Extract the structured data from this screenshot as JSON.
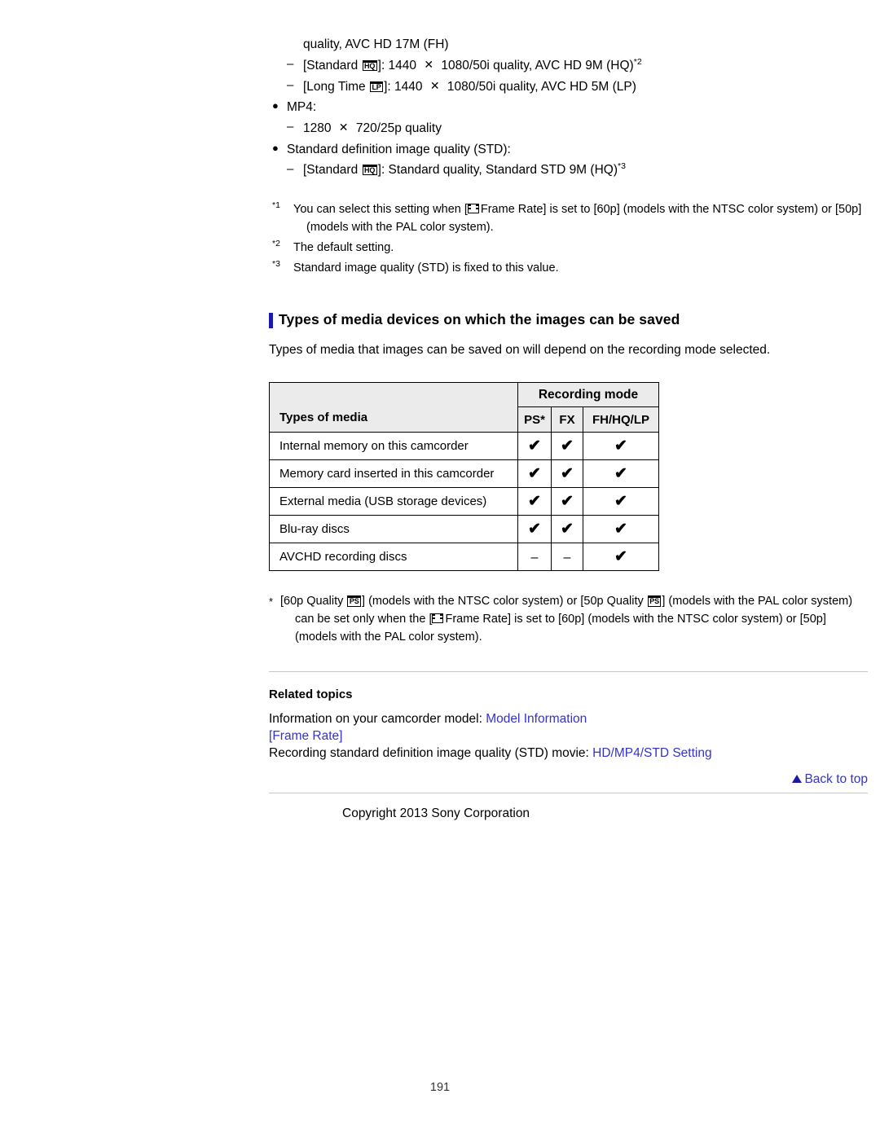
{
  "document": {
    "page_number": "191",
    "copyright": "Copyright 2013 Sony Corporation"
  },
  "spec_list": {
    "continuation_line": "quality, AVC HD 17M (FH)",
    "items": [
      {
        "type": "dash",
        "pre": "[Standard ",
        "icon": "HQ",
        "post_a": "]: 1440 ",
        "times": "✕",
        "post_b": " 1080/50i quality, AVC HD 9M (HQ)",
        "footnote": "*2"
      },
      {
        "type": "dash",
        "pre": "[Long Time ",
        "icon": "LP",
        "post_a": "]: 1440 ",
        "times": "✕",
        "post_b": " 1080/50i quality, AVC HD 5M (LP)",
        "footnote": ""
      }
    ],
    "bullet_mp4": "MP4:",
    "mp4_sub_pre": "1280 ",
    "mp4_sub_times": "✕",
    "mp4_sub_post": " 720/25p quality",
    "bullet_std": "Standard definition image quality (STD):",
    "std_sub_pre": "[Standard ",
    "std_sub_icon": "HQ",
    "std_sub_post": "]: Standard quality, Standard STD 9M (HQ)",
    "std_sub_footnote": "*3"
  },
  "footnotes": [
    {
      "mark": "*1",
      "text_before_icon": "You can select this setting when [",
      "icon": "frame-rate",
      "text_after_icon": "Frame Rate] is set to [60p] (models with the NTSC color system) or [50p]",
      "indent_line": "(models with the PAL color system)."
    },
    {
      "mark": "*2",
      "text_before_icon": "The default setting.",
      "icon": "",
      "text_after_icon": "",
      "indent_line": ""
    },
    {
      "mark": "*3",
      "text_before_icon": "Standard image quality (STD) is fixed to this value.",
      "icon": "",
      "text_after_icon": "",
      "indent_line": ""
    }
  ],
  "section": {
    "heading": "Types of media devices on which the images can be saved",
    "accent_color": "#1a1aaa",
    "intro": "Types of media that images can be saved on will depend on the recording mode selected."
  },
  "table": {
    "col_header_media": "Types of media",
    "group_header": "Recording mode",
    "mode_headers": [
      "PS*",
      "FX",
      "FH/HQ/LP"
    ],
    "header_bg": "#ebebeb",
    "check_glyph": "✔",
    "dash_glyph": "–",
    "rows": [
      {
        "media": "Internal memory on this camcorder",
        "values": [
          "check",
          "check",
          "check"
        ]
      },
      {
        "media": "Memory card inserted in this camcorder",
        "values": [
          "check",
          "check",
          "check"
        ]
      },
      {
        "media": "External media (USB storage devices)",
        "values": [
          "check",
          "check",
          "check"
        ]
      },
      {
        "media": "Blu-ray discs",
        "values": [
          "check",
          "check",
          "check"
        ]
      },
      {
        "media": "AVCHD recording discs",
        "values": [
          "dash",
          "dash",
          "check"
        ]
      }
    ]
  },
  "table_note": {
    "mark": "*",
    "part1": "[60p Quality ",
    "icon1": "PS",
    "part2": "] (models with the NTSC color system) or [50p Quality ",
    "icon2": "PS",
    "part3": "] (models with the PAL color system)",
    "line2_before_icon": "can be set only when the [",
    "line2_icon": "frame-rate",
    "line2_after_icon": "Frame Rate] is set to [60p] (models with the NTSC color system) or [50p]",
    "line3": "(models with the PAL color system)."
  },
  "related": {
    "title": "Related topics",
    "line1_text": "Information on your camcorder model: ",
    "line1_link": "Model Information",
    "line2_open": "[",
    "line2_link": "Frame Rate",
    "line2_close": "]",
    "line3_text": "Recording standard definition image quality (STD) movie: ",
    "line3_link": "HD/MP4/STD Setting",
    "back_to_top": "Back to top",
    "link_color": "#3333cc"
  }
}
